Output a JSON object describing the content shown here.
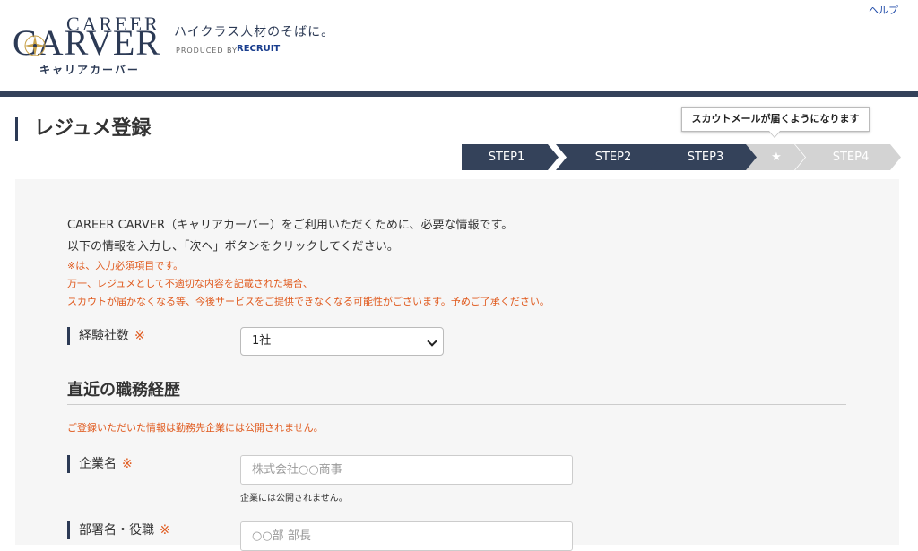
{
  "header": {
    "logo_top": "CAREER",
    "logo_main": "CARVER",
    "logo_kana": "キャリアカーバー",
    "tagline": "ハイクラス人材のそばに。",
    "produced_by": "PRODUCED BY",
    "recruit": "RECRUIT",
    "help_link": "ヘルプ"
  },
  "page": {
    "title": "レジュメ登録"
  },
  "steps": {
    "tooltip": "スカウトメールが届くようになります",
    "items": [
      {
        "label": "STEP1",
        "state": "done"
      },
      {
        "label": "STEP2",
        "state": "done"
      },
      {
        "label": "STEP3",
        "state": "current"
      },
      {
        "label": "★",
        "state": "upcoming"
      },
      {
        "label": "STEP4",
        "state": "upcoming"
      }
    ],
    "colors": {
      "active": "#34425a",
      "inactive": "#d3d3d3"
    }
  },
  "intro": {
    "line1": "CAREER CARVER（キャリアカーバー）をご利用いただくために、必要な情報です。",
    "line2": "以下の情報を入力し、「次へ」ボタンをクリックしてください。"
  },
  "notes": {
    "line1": "※は、入力必須項目です。",
    "line2": "万一、レジュメとして不適切な内容を記載された場合、",
    "line3": "スカウトが届かなくなる等、今後サービスをご提供できなくなる可能性がございます。予めご了承ください。"
  },
  "form": {
    "required_mark": "※",
    "experience_count": {
      "label": "経験社数",
      "value": "1社"
    },
    "recent_career": {
      "title": "直近の職務経歴",
      "note": "ご登録いただいた情報は勤務先企業には公開されません。"
    },
    "company": {
      "label": "企業名",
      "placeholder": "株式会社○○商事",
      "hint": "企業には公開されません。"
    },
    "department": {
      "label": "部署名・役職",
      "placeholder": "○○部 部長"
    }
  }
}
